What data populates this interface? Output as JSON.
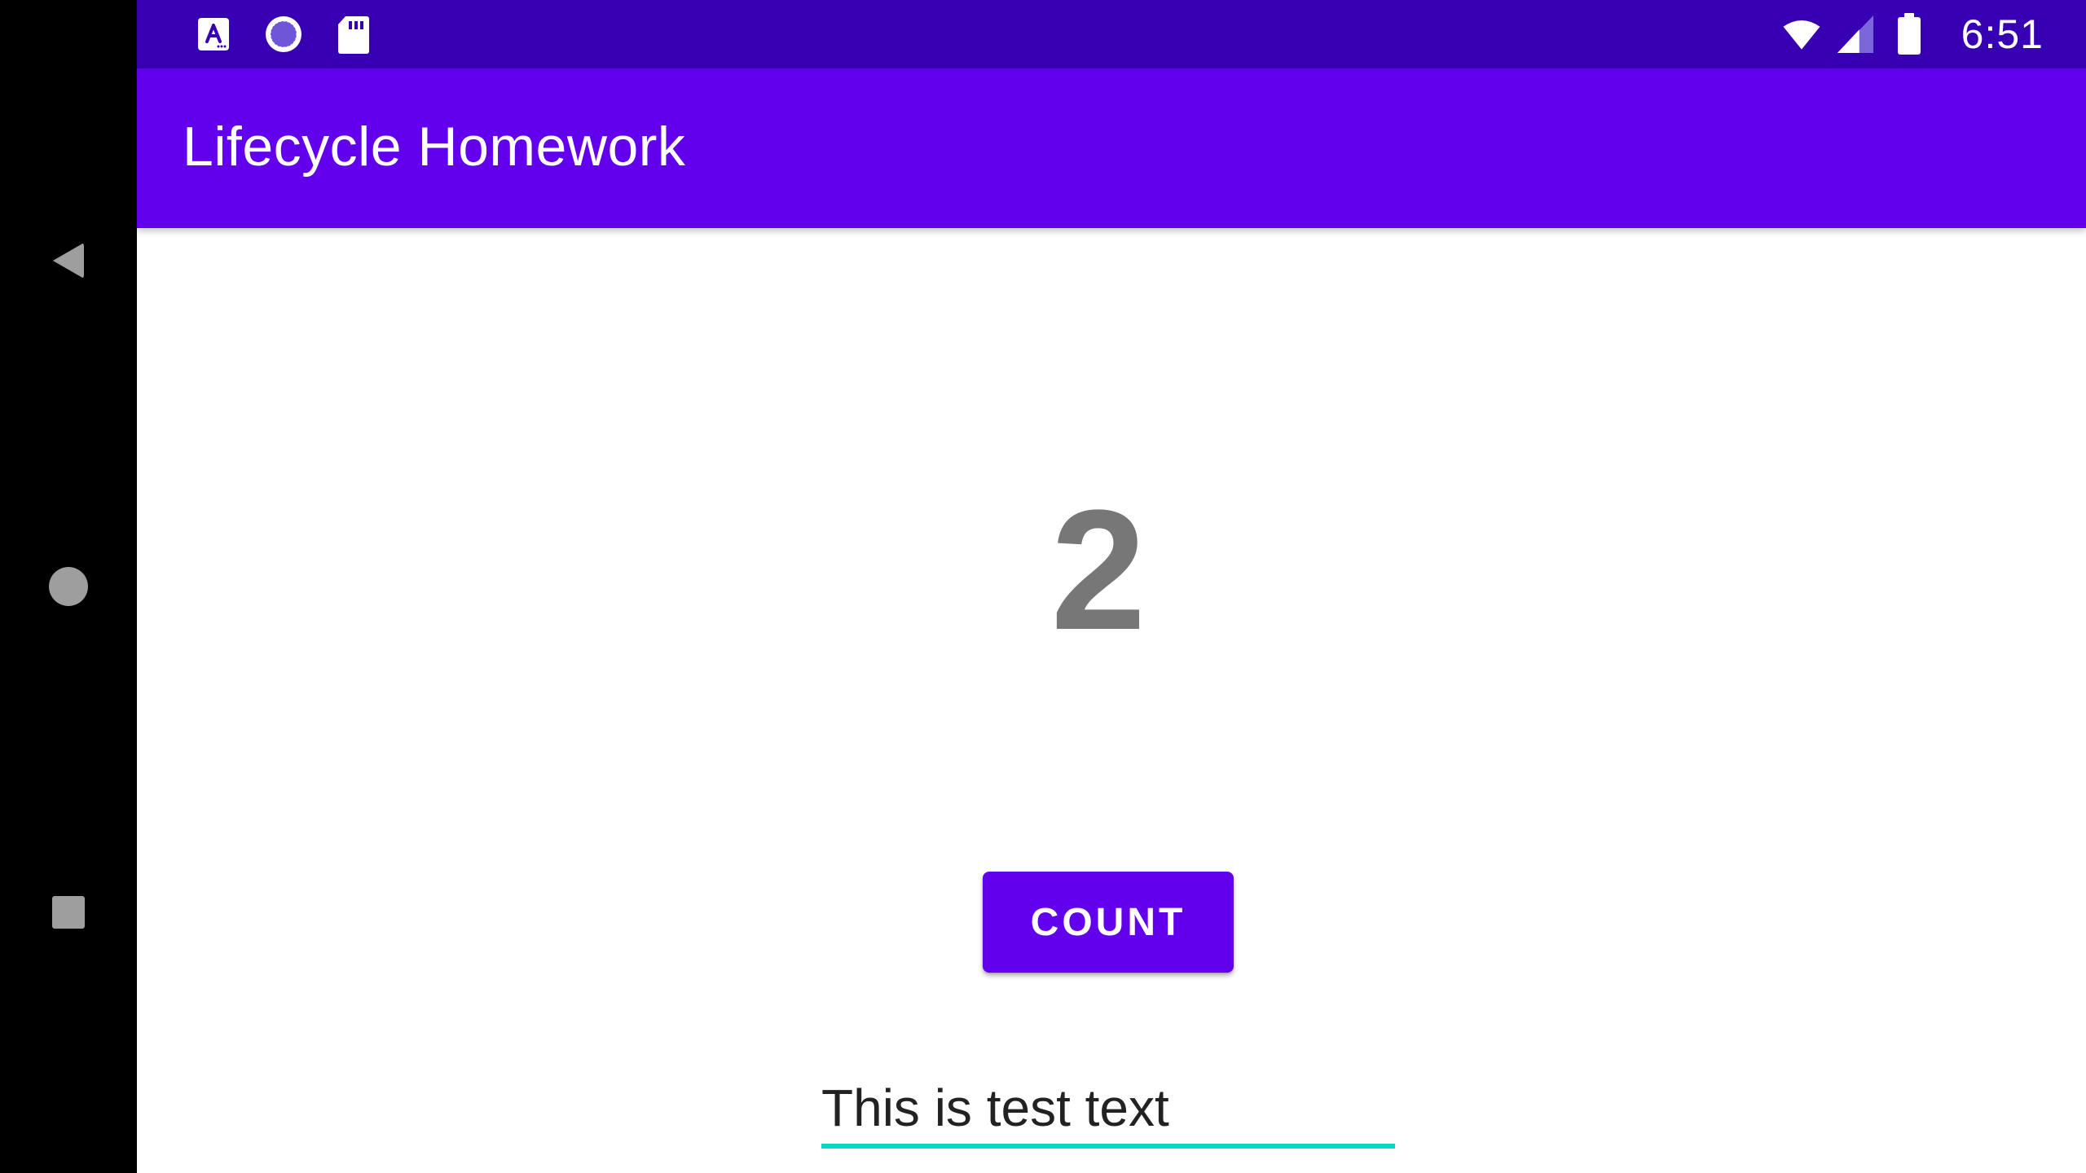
{
  "app": {
    "title": "Lifecycle Homework",
    "accent_color": "#6200ee",
    "status_bar_color": "#3700b3",
    "text_field_underline_color": "#03dac5"
  },
  "status_bar": {
    "time": "6:51",
    "left_icons": [
      "a-letter-icon",
      "loading-circle-icon",
      "sd-card-icon"
    ],
    "right_icons": [
      "wifi-icon",
      "cellular-signal-icon",
      "battery-icon"
    ]
  },
  "navigation": {
    "items": [
      "back-icon",
      "home-icon",
      "recent-apps-icon"
    ]
  },
  "main": {
    "counter_value": "2",
    "count_button_label": "COUNT",
    "text_field_value": "This is test text"
  }
}
